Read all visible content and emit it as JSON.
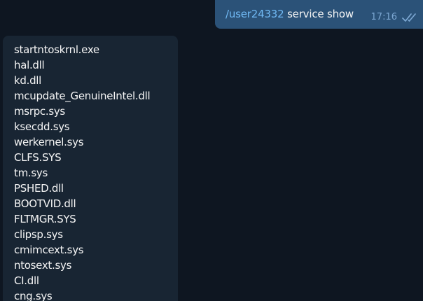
{
  "outgoing_message": {
    "command": "/user24332",
    "text": " service show",
    "time": "17:16",
    "status_icon": "double-check-read-icon"
  },
  "incoming_message": {
    "lines": [
      "startntoskrnl.exe",
      "hal.dll",
      "kd.dll",
      "mcupdate_GenuineIntel.dll",
      "msrpc.sys",
      "ksecdd.sys",
      "werkernel.sys",
      "CLFS.SYS",
      "tm.sys",
      "PSHED.dll",
      "BOOTVID.dll",
      "FLTMGR.SYS",
      "clipsp.sys",
      "cmimcext.sys",
      "ntosext.sys",
      "CI.dll",
      "cng.sys"
    ]
  },
  "colors": {
    "background": "#0e1621",
    "outgoing_bubble": "#2b5278",
    "incoming_bubble": "#182533",
    "link": "#71baf5",
    "time": "#7da8d3",
    "text": "#f5f5f5"
  }
}
